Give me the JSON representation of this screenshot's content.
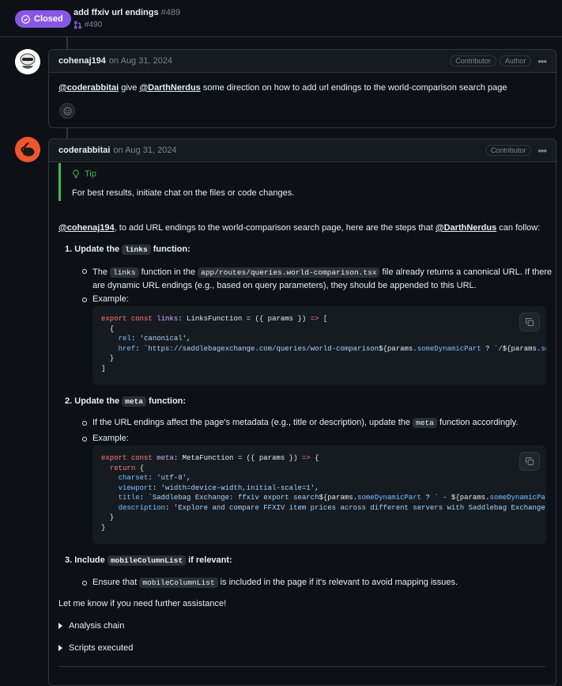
{
  "header": {
    "status": "Closed",
    "title": "add ffxiv url endings",
    "number": "#489",
    "linked_pr": "#490"
  },
  "comment1": {
    "author": "cohenaj194",
    "date": "on Aug 31, 2024",
    "badges": [
      "Contributor",
      "Author"
    ],
    "mention1": "@coderabbitai",
    "text1": " give ",
    "mention2": "@DarthNerdus",
    "text2": " some direction on how to add url endings to the world-comparison search page"
  },
  "comment2": {
    "author": "coderabbitai",
    "date": "on Aug 31, 2024",
    "badge": "Contributor",
    "tip_title": "Tip",
    "tip_text": "For best results, initiate chat on the files or code changes.",
    "intro_mention1": "@cohenaj194",
    "intro_text1": ", to add URL endings to the world-comparison search page, here are the steps that ",
    "intro_mention2": "@DarthNerdus",
    "intro_text2": " can follow:",
    "step1": {
      "num": "1.",
      "pre": "Update the ",
      "code": "links",
      "post": " function:",
      "b1_pre": "The ",
      "b1_code1": "links",
      "b1_mid": " function in the ",
      "b1_code2": "app/routes/queries.world-comparison.tsx",
      "b1_post": " file already returns a canonical URL. If there",
      "b1_line2": "are dynamic URL endings (e.g., based on query parameters), they should be appended to this URL.",
      "b2": "Example:"
    },
    "code1": [
      "export const links: LinksFunction = ({ params }) => [",
      "  {",
      "    rel: 'canonical',",
      "    href: `https://saddlebagexchange.com/queries/world-comparison${params.someDynamicPart ? `/${params.so",
      "  }",
      "]"
    ],
    "step2": {
      "num": "2.",
      "pre": "Update the ",
      "code": "meta",
      "post": " function:",
      "b1_pre": "If the URL endings affect the page's metadata (e.g., title or description), update the ",
      "b1_code": "meta",
      "b1_post": " function accordingly.",
      "b2": "Example:"
    },
    "code2": [
      "export const meta: MetaFunction = ({ params }) => {",
      "  return {",
      "    charset: 'utf-8',",
      "    viewport: 'width=device-width,initial-scale=1',",
      "    title: `Saddlebag Exchange: ffxiv export search${params.someDynamicPart ? ` - ${params.someDynamicPar",
      "    description: 'Explore and compare FFXIV item prices across different servers with Saddlebag Exchange.",
      "  }",
      "}"
    ],
    "step3": {
      "num": "3.",
      "pre": "Include ",
      "code": "mobileColumnList",
      "post": " if relevant:",
      "b1_pre": "Ensure that ",
      "b1_code": "mobileColumnList",
      "b1_post": " is included in the page if it's relevant to avoid mapping issues."
    },
    "closing": "Let me know if you need further assistance!",
    "details1": "Analysis chain",
    "details2": "Scripts executed"
  },
  "icons": {
    "closed": "check-circle-icon",
    "branch": "git-pull-request-icon",
    "smile": "smiley-icon",
    "bulb": "lightbulb-icon",
    "copy": "copy-icon",
    "kebab": "kebab-icon"
  },
  "colors": {
    "closed_badge": "#8957e5",
    "tip_accent": "#3fb950",
    "background": "#0d1117"
  }
}
